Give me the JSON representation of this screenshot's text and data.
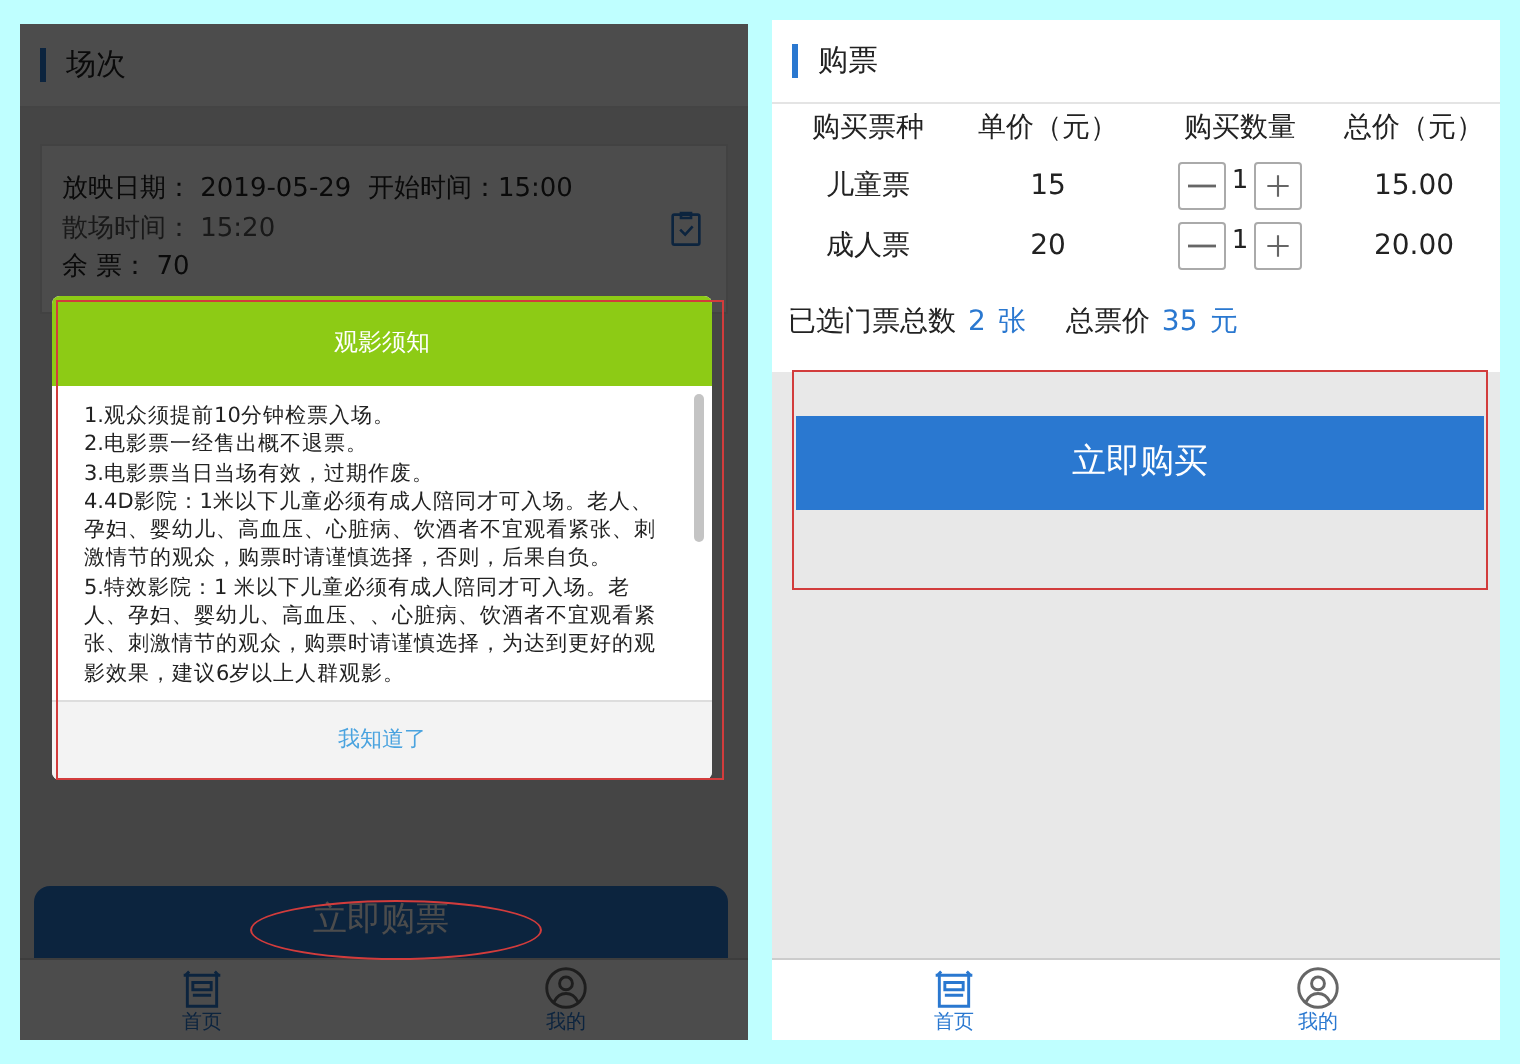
{
  "left_screen": {
    "section_title": "场次",
    "showing": {
      "date_label": "放映日期：",
      "date": "2019-05-29",
      "start_label": "开始时间：",
      "start": "15:00",
      "end_label": "散场时间：",
      "end": "15:20",
      "remaining_label": "余 票：",
      "remaining": "70"
    },
    "notice_dialog": {
      "title": "观影须知",
      "lines": [
        "1.观众须提前10分钟检票入场。",
        "2.电影票一经售出概不退票。",
        "3.电影票当日当场有效，过期作废。",
        "4.4D影院：1米以下儿童必须有成人陪同才可入场。老人、孕妇、婴幼儿、高血压、心脏病、饮酒者不宜观看紧张、刺激情节的观众，购票时请谨慎选择，否则，后果自负。",
        "5.特效影院：1 米以下儿童必须有成人陪同才可入场。老人、孕妇、婴幼儿、高血压、、心脏病、饮酒者不宜观看紧张、刺激情节的观众，购票时请谨慎选择，为达到更好的观影效果，建议6岁以上人群观影。"
      ],
      "confirm": "我知道了"
    },
    "buy_button": "立即购票",
    "tabs": [
      {
        "label": "首页",
        "kind": "home",
        "selected": true
      },
      {
        "label": "我的",
        "kind": "user",
        "selected": false
      }
    ]
  },
  "right_screen": {
    "section_title": "购票",
    "columns": [
      "购买票种",
      "单价（元）",
      "购买数量",
      "总价（元）"
    ],
    "rows": [
      {
        "type": "儿童票",
        "price": "15",
        "quantity": "1",
        "total": "15.00"
      },
      {
        "type": "成人票",
        "price": "20",
        "quantity": "1",
        "total": "20.00"
      }
    ],
    "summary": {
      "count_label": "已选门票总数",
      "count": "2",
      "count_unit": "张",
      "price_label": "总票价",
      "price": "35",
      "price_unit": "元"
    },
    "buy_button": "立即购买",
    "tabs": [
      {
        "label": "首页",
        "kind": "home",
        "selected": true
      },
      {
        "label": "我的",
        "kind": "user",
        "selected": false
      }
    ]
  }
}
